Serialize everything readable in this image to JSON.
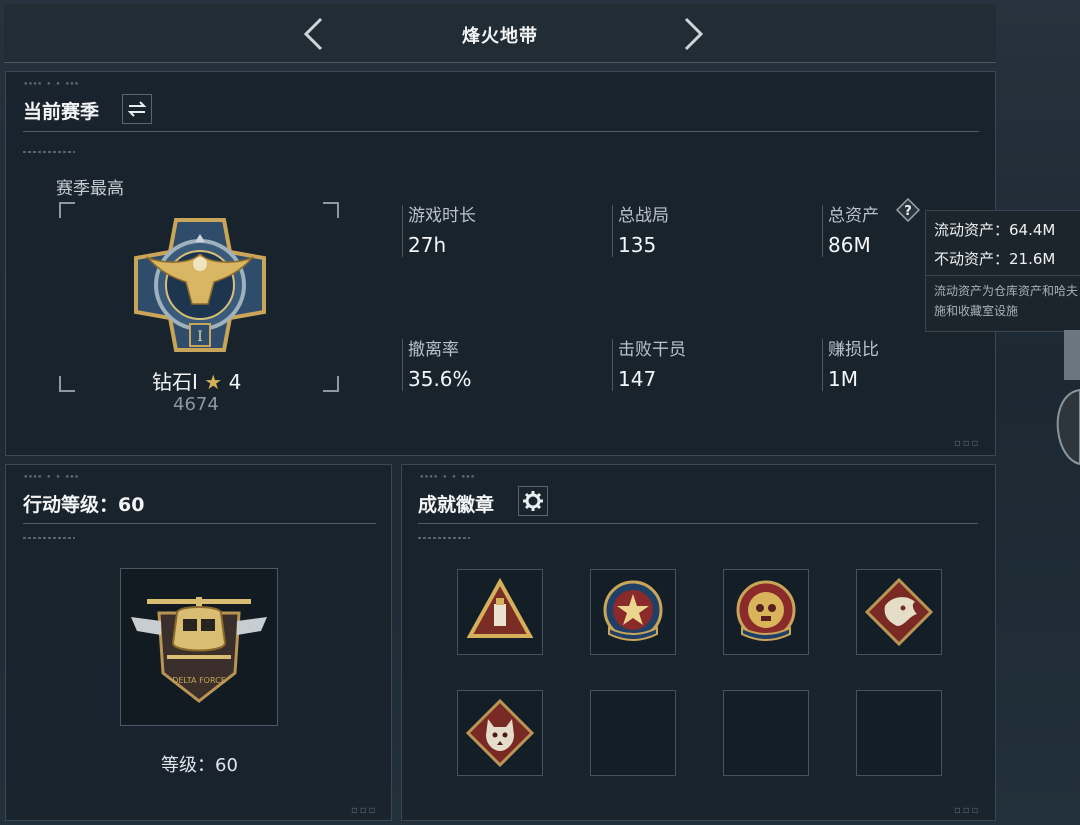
{
  "header": {
    "title": "烽火地带"
  },
  "season_panel": {
    "title": "当前赛季",
    "best_label": "赛季最高",
    "rank_name": "钻石I",
    "rank_stars": "4",
    "rank_score": "4674",
    "stats": [
      {
        "label": "游戏时长",
        "value": "27h"
      },
      {
        "label": "总战局",
        "value": "135"
      },
      {
        "label": "总资产",
        "value": "86M"
      },
      {
        "label": "撤离率",
        "value": "35.6%"
      },
      {
        "label": "击败干员",
        "value": "147"
      },
      {
        "label": "赚损比",
        "value": "1M"
      }
    ]
  },
  "tooltip": {
    "liquid": "流动资产：64.4M",
    "fixed": "不动资产：21.6M",
    "note_line1": "流动资产为仓库资产和哈夫",
    "note_line2": "施和收藏室设施"
  },
  "level_panel": {
    "title": "行动等级：60",
    "level_text": "等级：60",
    "emblem_text": "DELTA FORCE"
  },
  "badges_panel": {
    "title": "成就徽章",
    "badges": [
      "triangle-usb-badge-icon",
      "star-shield-badge-icon",
      "skull-shield-badge-icon",
      "dragon-diamond-badge-icon",
      "wolf-diamond-badge-icon",
      "",
      "",
      ""
    ]
  },
  "colors": {
    "accent_gold": "#c9a55a",
    "panel_bg": "#18222b",
    "border": "#3a4853"
  }
}
